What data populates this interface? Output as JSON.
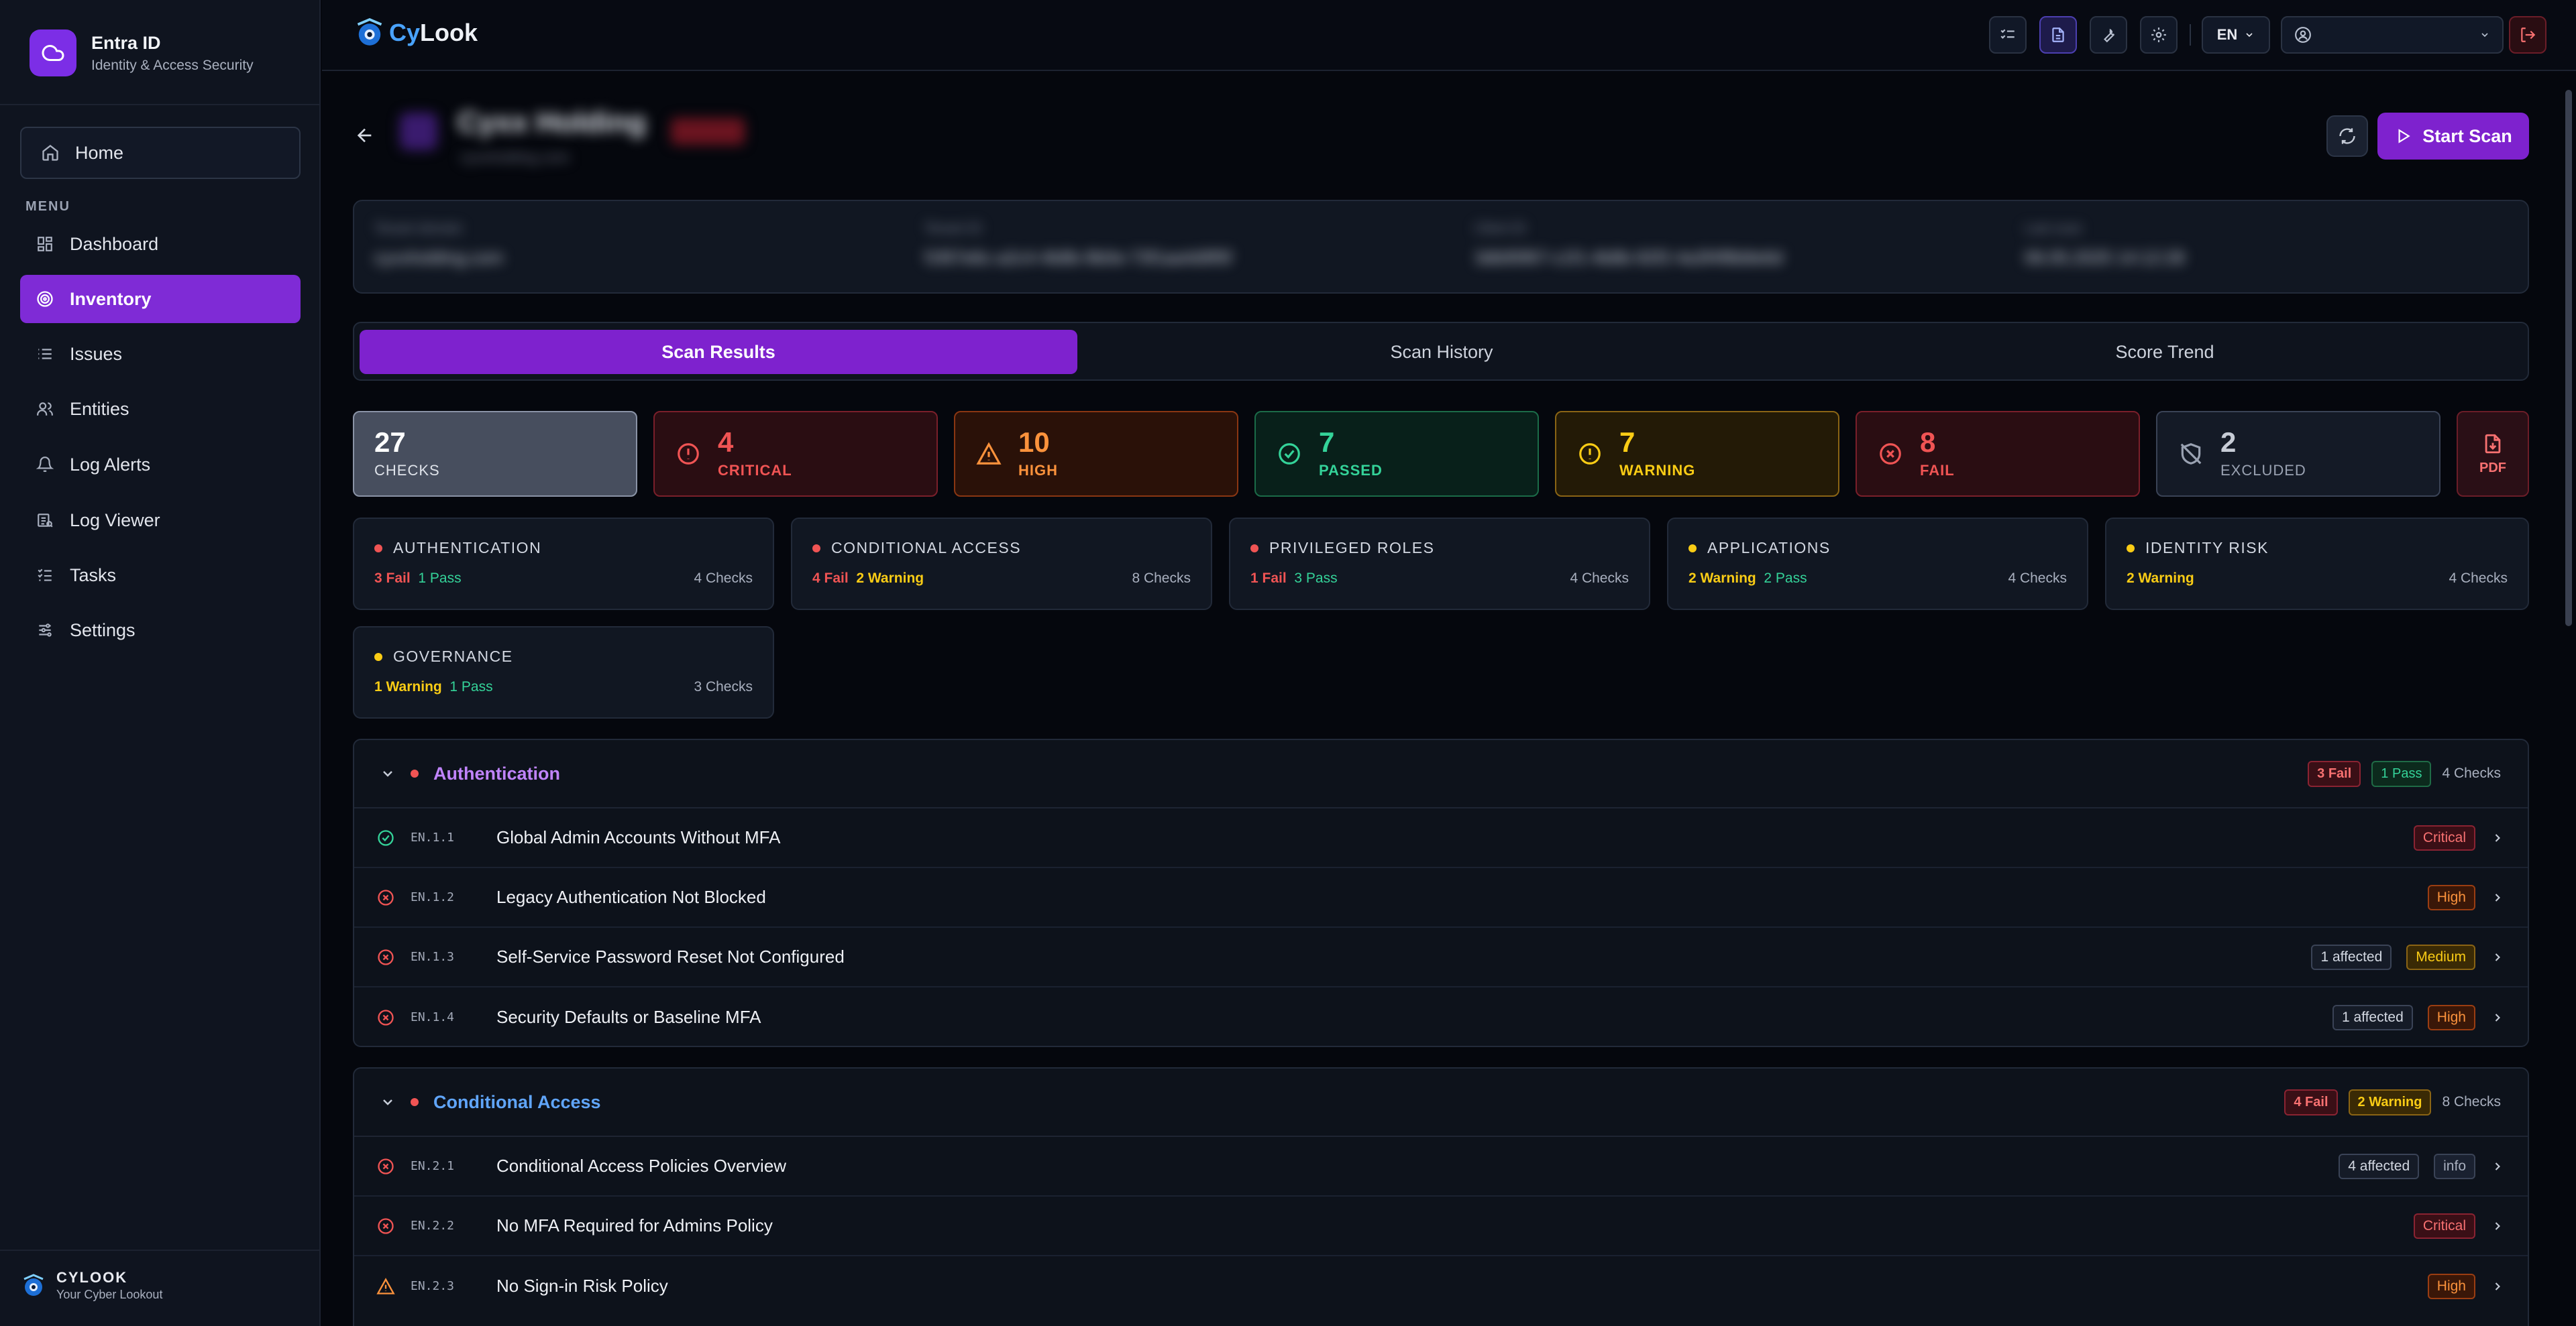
{
  "sidebar": {
    "brand_title": "Entra ID",
    "brand_sub": "Identity & Access Security",
    "home_label": "Home",
    "menu_label": "MENU",
    "items": [
      {
        "label": "Dashboard",
        "icon": "grid-icon"
      },
      {
        "label": "Inventory",
        "icon": "target-icon",
        "active": true
      },
      {
        "label": "Issues",
        "icon": "list-icon"
      },
      {
        "label": "Entities",
        "icon": "users-icon"
      },
      {
        "label": "Log Alerts",
        "icon": "bell-icon"
      },
      {
        "label": "Log Viewer",
        "icon": "log-viewer-icon"
      },
      {
        "label": "Tasks",
        "icon": "tasks-icon"
      },
      {
        "label": "Settings",
        "icon": "sliders-icon"
      }
    ],
    "footer_title": "CYLOOK",
    "footer_sub": "Your Cyber Lookout"
  },
  "topbar": {
    "logo_cy": "Cy",
    "logo_look": "Look",
    "lang": "EN"
  },
  "header": {
    "tenant_name": "Cyxx Holding",
    "tenant_sub": "cyxxholding.com",
    "refresh_icon": "refresh-icon",
    "start_scan_label": "Start Scan",
    "info": [
      {
        "label": "Tenant domain",
        "value": "cyxxholding.com"
      },
      {
        "label": "Tenant ID",
        "value": "f1f67e6c-a2c4-4b8b-9b0e-73f1aa4d9f5f"
      },
      {
        "label": "Client ID",
        "value": "3db95f67-c1f1-4b8b-92f2-4a3f4f8b8e6d"
      },
      {
        "label": "Last scan",
        "value": "06.05.2025 14:12:28"
      }
    ]
  },
  "tabs": [
    "Scan Results",
    "Scan History",
    "Score Trend"
  ],
  "stats": [
    {
      "value": "27",
      "label": "CHECKS"
    },
    {
      "value": "4",
      "label": "CRITICAL"
    },
    {
      "value": "10",
      "label": "HIGH"
    },
    {
      "value": "7",
      "label": "PASSED"
    },
    {
      "value": "7",
      "label": "WARNING"
    },
    {
      "value": "8",
      "label": "FAIL"
    },
    {
      "value": "2",
      "label": "EXCLUDED"
    }
  ],
  "pdf_label": "PDF",
  "categories": [
    {
      "title": "AUTHENTICATION",
      "a": "3 Fail",
      "b": "1 Pass",
      "count": "4 Checks"
    },
    {
      "title": "CONDITIONAL ACCESS",
      "a": "4 Fail",
      "b": "2 Warning",
      "count": "8 Checks"
    },
    {
      "title": "PRIVILEGED ROLES",
      "a": "1 Fail",
      "b": "3 Pass",
      "count": "4 Checks"
    },
    {
      "title": "APPLICATIONS",
      "a": "2 Warning",
      "b": "2 Pass",
      "count": "4 Checks"
    },
    {
      "title": "IDENTITY RISK",
      "a": "2 Warning",
      "b": "",
      "count": "4 Checks"
    },
    {
      "title": "GOVERNANCE",
      "a": "1 Warning",
      "b": "1 Pass",
      "count": "3 Checks"
    }
  ],
  "sections": [
    {
      "title": "Authentication",
      "pill_a": "3 Fail",
      "pill_b": "1 Pass",
      "count": "4 Checks",
      "rows": [
        {
          "id": "EN.1.1",
          "title": "Global Admin Accounts Without MFA",
          "affected": "",
          "severity": "Critical",
          "status": "pass"
        },
        {
          "id": "EN.1.2",
          "title": "Legacy Authentication Not Blocked",
          "affected": "",
          "severity": "High",
          "status": "fail"
        },
        {
          "id": "EN.1.3",
          "title": "Self-Service Password Reset Not Configured",
          "affected": "1 affected",
          "severity": "Medium",
          "status": "fail"
        },
        {
          "id": "EN.1.4",
          "title": "Security Defaults or Baseline MFA",
          "affected": "1 affected",
          "severity": "High",
          "status": "fail"
        }
      ]
    },
    {
      "title": "Conditional Access",
      "pill_a": "4 Fail",
      "pill_b": "2 Warning",
      "count": "8 Checks",
      "rows": [
        {
          "id": "EN.2.1",
          "title": "Conditional Access Policies Overview",
          "affected": "4 affected",
          "severity": "info",
          "status": "fail"
        },
        {
          "id": "EN.2.2",
          "title": "No MFA Required for Admins Policy",
          "affected": "",
          "severity": "Critical",
          "status": "fail"
        },
        {
          "id": "EN.2.3",
          "title": "No Sign-in Risk Policy",
          "affected": "",
          "severity": "High",
          "status": "warn"
        }
      ]
    }
  ],
  "colors": {
    "accent": "#7e22ce",
    "critical": "#f05454",
    "high": "#fb923c",
    "passed": "#34d399",
    "warning": "#facc15",
    "excluded": "#9aa2b2"
  }
}
